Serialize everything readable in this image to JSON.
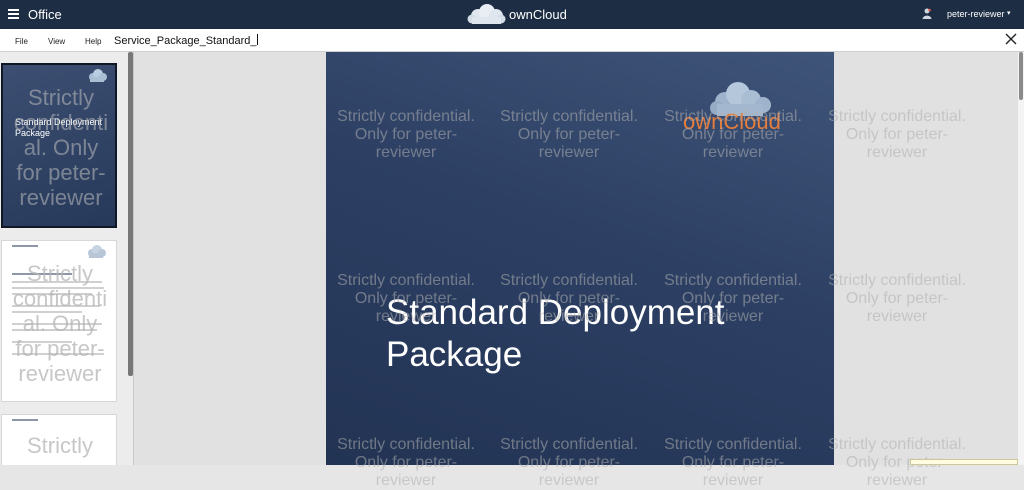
{
  "appbar": {
    "app_name": "Office",
    "brand_name": "ownCloud",
    "user_name": "peter-reviewer",
    "caret": "▾"
  },
  "toolbar": {
    "menus": [
      "File",
      "View",
      "Help"
    ],
    "document_title": "Service_Package_Standard_"
  },
  "slide": {
    "title": "Standard Deployment\nPackage",
    "logo_text": "ownCloud"
  },
  "thumbnails": [
    {
      "title": "Standard Deployment\nPackage",
      "watermark": "Strictly\nconfidenti\nal. Only\nfor peter-\nreviewer"
    },
    {
      "watermark": "Strictly\nconfidenti\nal. Only\nfor peter-\nreviewer"
    },
    {
      "watermark": "Strictly"
    }
  ],
  "watermark": {
    "text": "Strictly confidential.\nOnly for peter-\nreviewer"
  },
  "colors": {
    "appbar": "#1d2d44",
    "slide": "#2d4064",
    "brand_orange": "#e57d3c"
  }
}
